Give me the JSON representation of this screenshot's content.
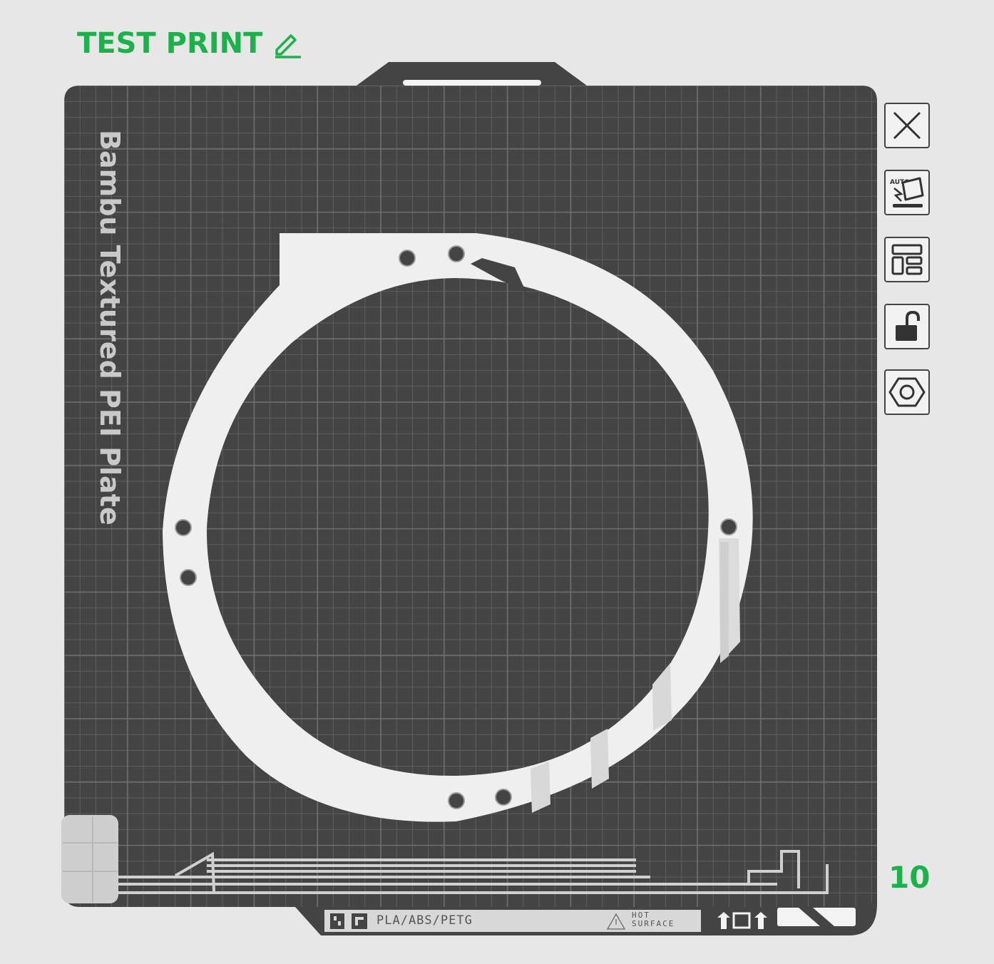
{
  "plate": {
    "title": "TEST PRINT",
    "index": "10",
    "bed_label": "Bambu Textured PEI Plate",
    "filaments": "PLA/ABS/PETG",
    "warning_top": "HOT",
    "warning_bottom": "SURFACE"
  },
  "colors": {
    "accent": "#1db14b",
    "bed": "#434443",
    "grid": "#6f706f",
    "part": "#f0f0f0",
    "background": "#e7e7e7"
  },
  "toolbar": {
    "auto_label": "AUTO",
    "items": [
      {
        "id": "close",
        "icon": "close-icon"
      },
      {
        "id": "auto-orient",
        "icon": "auto-orient-icon"
      },
      {
        "id": "arrange",
        "icon": "arrange-icon"
      },
      {
        "id": "lock",
        "icon": "unlock-icon"
      },
      {
        "id": "settings",
        "icon": "hex-settings-icon"
      }
    ]
  }
}
